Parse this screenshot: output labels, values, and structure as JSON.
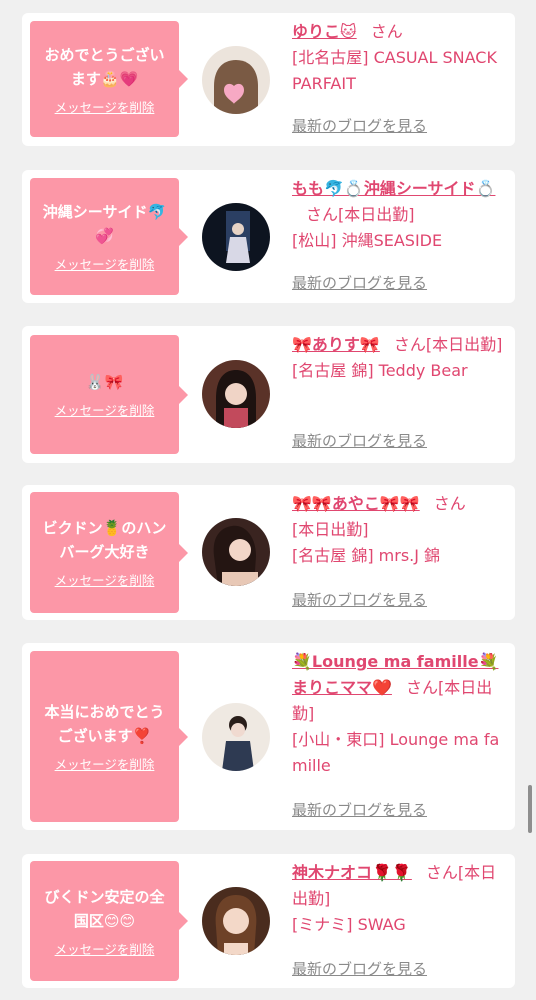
{
  "cards": [
    {
      "message": "おめでとうございます🎂💗",
      "delete_label": "メッセージを削除",
      "name": "ゆりこ🐱",
      "san": "さん",
      "status": "",
      "shop": "[北名古屋] CASUAL SNACK PARFAIT",
      "blog_link": "最新のブログを見る"
    },
    {
      "message": "沖縄シーサイド🐬💞",
      "delete_label": "メッセージを削除",
      "name": "もも🐬💍沖縄シーサイド💍",
      "san": "さん",
      "status": "[本日出勤]",
      "shop": "[松山] 沖縄SEASIDE",
      "blog_link": "最新のブログを見る"
    },
    {
      "message": "🐰🎀",
      "delete_label": "メッセージを削除",
      "name": "🎀ありす🎀",
      "san": "さん",
      "status": "[本日出勤]",
      "shop": "[名古屋 錦] Teddy Bear",
      "blog_link": "最新のブログを見る"
    },
    {
      "message": "ビクドン🍍のハンバーグ大好き",
      "delete_label": "メッセージを削除",
      "name": "🎀🎀あやこ🎀🎀",
      "san": "さん",
      "status": "[本日出勤]",
      "shop": "[名古屋 錦] mrs.J 錦",
      "blog_link": "最新のブログを見る"
    },
    {
      "message": "本当におめでとうございます❣️",
      "delete_label": "メッセージを削除",
      "name": "💐Lounge ma famille💐まりこママ❤️",
      "san": "さん",
      "status": "[本日出勤]",
      "shop": "[小山・東口] Lounge ma famille",
      "blog_link": "最新のブログを見る"
    },
    {
      "message": "びくドン安定の全国区😊😊",
      "delete_label": "メッセージを削除",
      "name": "神木ナオコ🌹🌹",
      "san": "さん",
      "status": "[本日出勤]",
      "shop": "[ミナミ] SWAG",
      "blog_link": "最新のブログを見る"
    }
  ]
}
